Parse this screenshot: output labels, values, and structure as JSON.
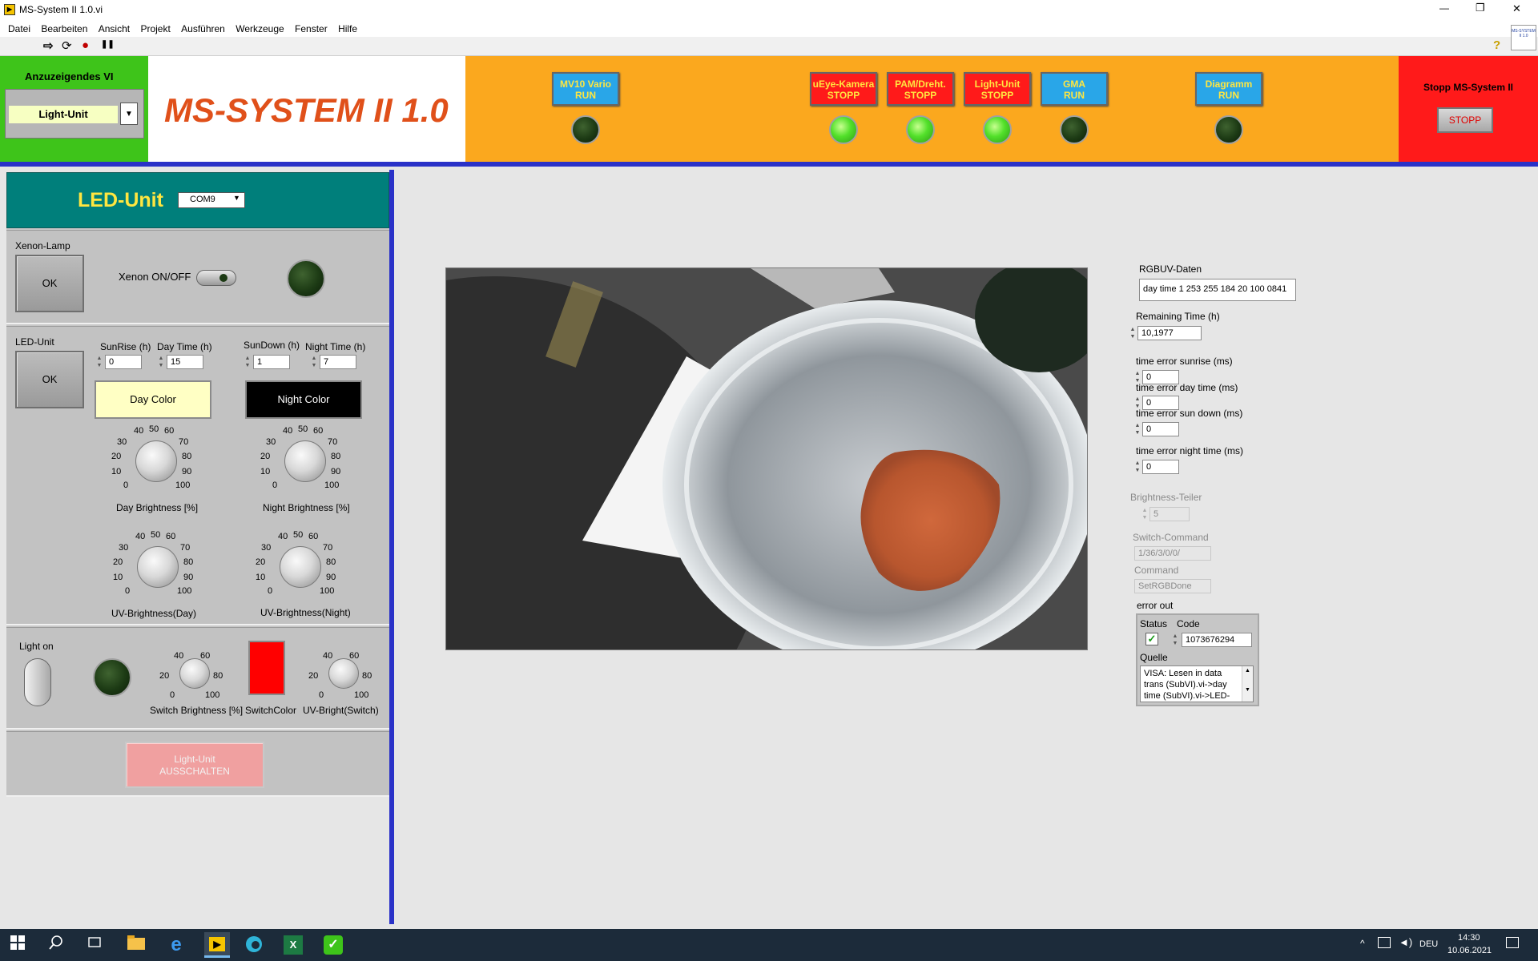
{
  "window": {
    "title": "MS-System II 1.0.vi",
    "min": "—",
    "max": "❐",
    "close": "✕"
  },
  "menu": [
    "Datei",
    "Bearbeiten",
    "Ansicht",
    "Projekt",
    "Ausführen",
    "Werkzeuge",
    "Fenster",
    "Hilfe"
  ],
  "toolbar": {
    "run": "⇨",
    "run_cont": "⟳",
    "abort": "●",
    "pause": "❚❚",
    "help": "?",
    "vi_icon": "MS-SYSTEM II 1.0"
  },
  "header": {
    "anzeige_label": "Anzuzeigendes VI",
    "anzeige_value": "Light-Unit",
    "app_title": "MS-SYSTEM II 1.0",
    "vi_buttons": [
      {
        "line1": "MV10 Vario",
        "line2": "RUN",
        "color": "#29a6e8",
        "led": "off"
      },
      {
        "line1": "uEye-Kamera",
        "line2": "STOPP",
        "color": "#ff1a1a",
        "led": "on"
      },
      {
        "line1": "PAM/Dreht.",
        "line2": "STOPP",
        "color": "#ff1a1a",
        "led": "on"
      },
      {
        "line1": "Light-Unit",
        "line2": "STOPP",
        "color": "#ff1a1a",
        "led": "on"
      },
      {
        "line1": "GMA",
        "line2": "RUN",
        "color": "#29a6e8",
        "led": "off"
      },
      {
        "line1": "Diagramm",
        "line2": "RUN",
        "color": "#29a6e8",
        "led": "off"
      }
    ],
    "stop_label": "Stopp MS-System II",
    "stop_button": "STOPP"
  },
  "led_unit": {
    "title": "LED-Unit",
    "port": "COM9",
    "xenon_lamp_label": "Xenon-Lamp",
    "xenon_ok": "OK",
    "xenon_switch_label": "Xenon ON/OFF",
    "ledunit_label": "LED-Unit",
    "ledunit_ok": "OK",
    "sunrise_label": "SunRise (h)",
    "sunrise_value": "0",
    "daytime_label": "Day Time (h)",
    "daytime_value": "15",
    "sundown_label": "SunDown (h)",
    "sundown_value": "1",
    "nighttime_label": "Night Time (h)",
    "nighttime_value": "7",
    "day_color": "Day Color",
    "night_color": "Night Color",
    "day_brightness_label": "Day Brightness [%]",
    "night_brightness_label": "Night Brightness  [%]",
    "uv_day_label": "UV-Brightness(Day)",
    "uv_night_label": "UV-Brightness(Night)",
    "dial_ticks": [
      "0",
      "10",
      "20",
      "30",
      "40",
      "50",
      "60",
      "70",
      "80",
      "90",
      "100"
    ],
    "small_dial_ticks": [
      "0",
      "20",
      "40",
      "60",
      "80",
      "100"
    ],
    "light_on_label": "Light on",
    "switch_brightness_label": "Switch Brightness [%]",
    "switch_color_label": "SwitchColor",
    "uv_switch_label": "UV-Bright(Switch)",
    "shutdown_line1": "Light-Unit",
    "shutdown_line2": "AUSSCHALTEN"
  },
  "info": {
    "rgbuv_label": "RGBUV-Daten",
    "rgbuv_value": "day time 1 253 255 184 20 100 0841",
    "remaining_label": "Remaining Time (h)",
    "remaining_value": "10,1977",
    "err_sunrise_label": "time error sunrise (ms)",
    "err_sunrise_value": "0",
    "err_day_label": "time error day time (ms)",
    "err_day_value": "0",
    "err_sundown_label": "time error sun down (ms)",
    "err_sundown_value": "0",
    "err_night_label": "time error night time (ms)",
    "err_night_value": "0",
    "brightness_teiler_label": "Brightness-Teiler",
    "brightness_teiler_value": "5",
    "switch_command_label": "Switch-Command",
    "switch_command_value": "1/36/3/0/0/",
    "command_label": "Command",
    "command_value": "SetRGBDone",
    "error_out_label": "error out",
    "status_label": "Status",
    "code_label": "Code",
    "code_value": "1073676294",
    "quelle_label": "Quelle",
    "quelle_value": "VISA: Lesen in data trans (SubVI).vi->day time (SubVI).vi->LED-"
  },
  "taskbar": {
    "time": "14:30",
    "date": "10.06.2021",
    "lang": "DEU"
  },
  "colors": {
    "day_color": "#ffffc4",
    "night_color": "#000000",
    "switch_color": "#ff0000",
    "teal": "#007f7b"
  }
}
